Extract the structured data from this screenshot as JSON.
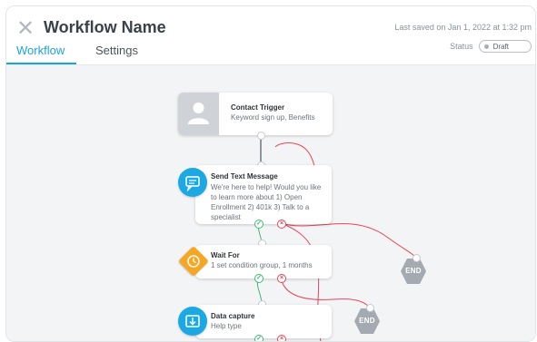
{
  "header": {
    "close_icon": "close-icon",
    "title": "Workflow Name",
    "last_saved": "Last saved on Jan 1, 2022 at 1:32 pm",
    "status_label": "Status",
    "status_value": "Draft"
  },
  "tabs": [
    {
      "label": "Workflow",
      "active": true
    },
    {
      "label": "Settings",
      "active": false
    }
  ],
  "nodes": {
    "contact_trigger": {
      "title": "Contact Trigger",
      "subtitle": "Keyword sign up, Benefits",
      "icon": "person-icon"
    },
    "send_text": {
      "title": "Send Text Message",
      "body": "We're here to help! Would you like to learn more about 1) Open Enrollment 2) 401k 3) Talk to a specialist",
      "icon": "message-icon"
    },
    "wait_for": {
      "title": "Wait For",
      "subtitle": "1 set condition group, 1 months",
      "icon": "clock-icon"
    },
    "data_capture": {
      "title": "Data capture",
      "subtitle": "Help type",
      "icon": "download-icon"
    }
  },
  "end_nodes": [
    "END",
    "END"
  ],
  "colors": {
    "accent": "#1aa3dc",
    "yes_link": "#3dbb72",
    "no_link": "#e8465a",
    "wait_icon": "#f5a623",
    "end_node": "#a3aab1"
  }
}
